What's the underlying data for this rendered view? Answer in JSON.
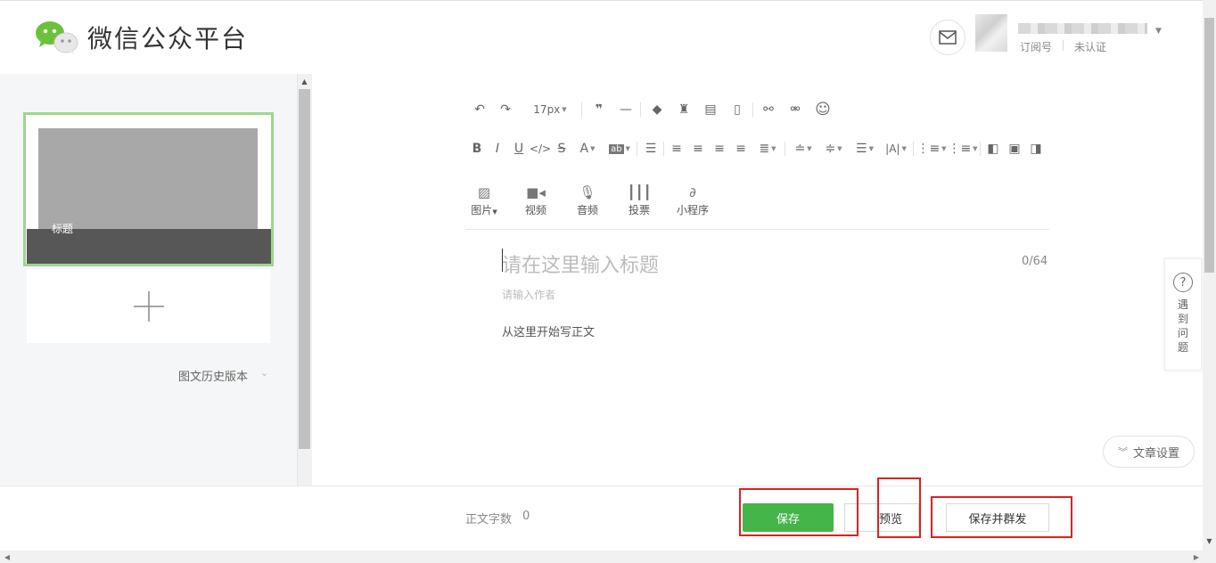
{
  "header": {
    "brand": "微信公众平台",
    "account_type": "订阅号",
    "account_status": "未认证"
  },
  "sidebar": {
    "article_title": "标题",
    "history_label": "图文历史版本"
  },
  "toolbar": {
    "font_size": "17px",
    "media": [
      {
        "label": "图片",
        "icon": "image-icon"
      },
      {
        "label": "视频",
        "icon": "video-icon"
      },
      {
        "label": "音频",
        "icon": "mic-icon"
      },
      {
        "label": "投票",
        "icon": "vote-icon"
      },
      {
        "label": "小程序",
        "icon": "miniprogram-icon"
      }
    ]
  },
  "editor": {
    "title_placeholder": "请在这里输入标题",
    "title_count": "0/64",
    "author_placeholder": "请输入作者",
    "body_placeholder": "从这里开始写正文"
  },
  "right": {
    "help_text": "遇到问题",
    "settings_label": "文章设置"
  },
  "footer": {
    "word_count_label": "正文字数",
    "word_count_value": "0",
    "save_label": "保存",
    "preview_label": "预览",
    "publish_label": "保存并群发"
  },
  "colors": {
    "primary_green": "#44b549",
    "highlight_red": "#e02020",
    "selected_border": "#9fd58e"
  }
}
